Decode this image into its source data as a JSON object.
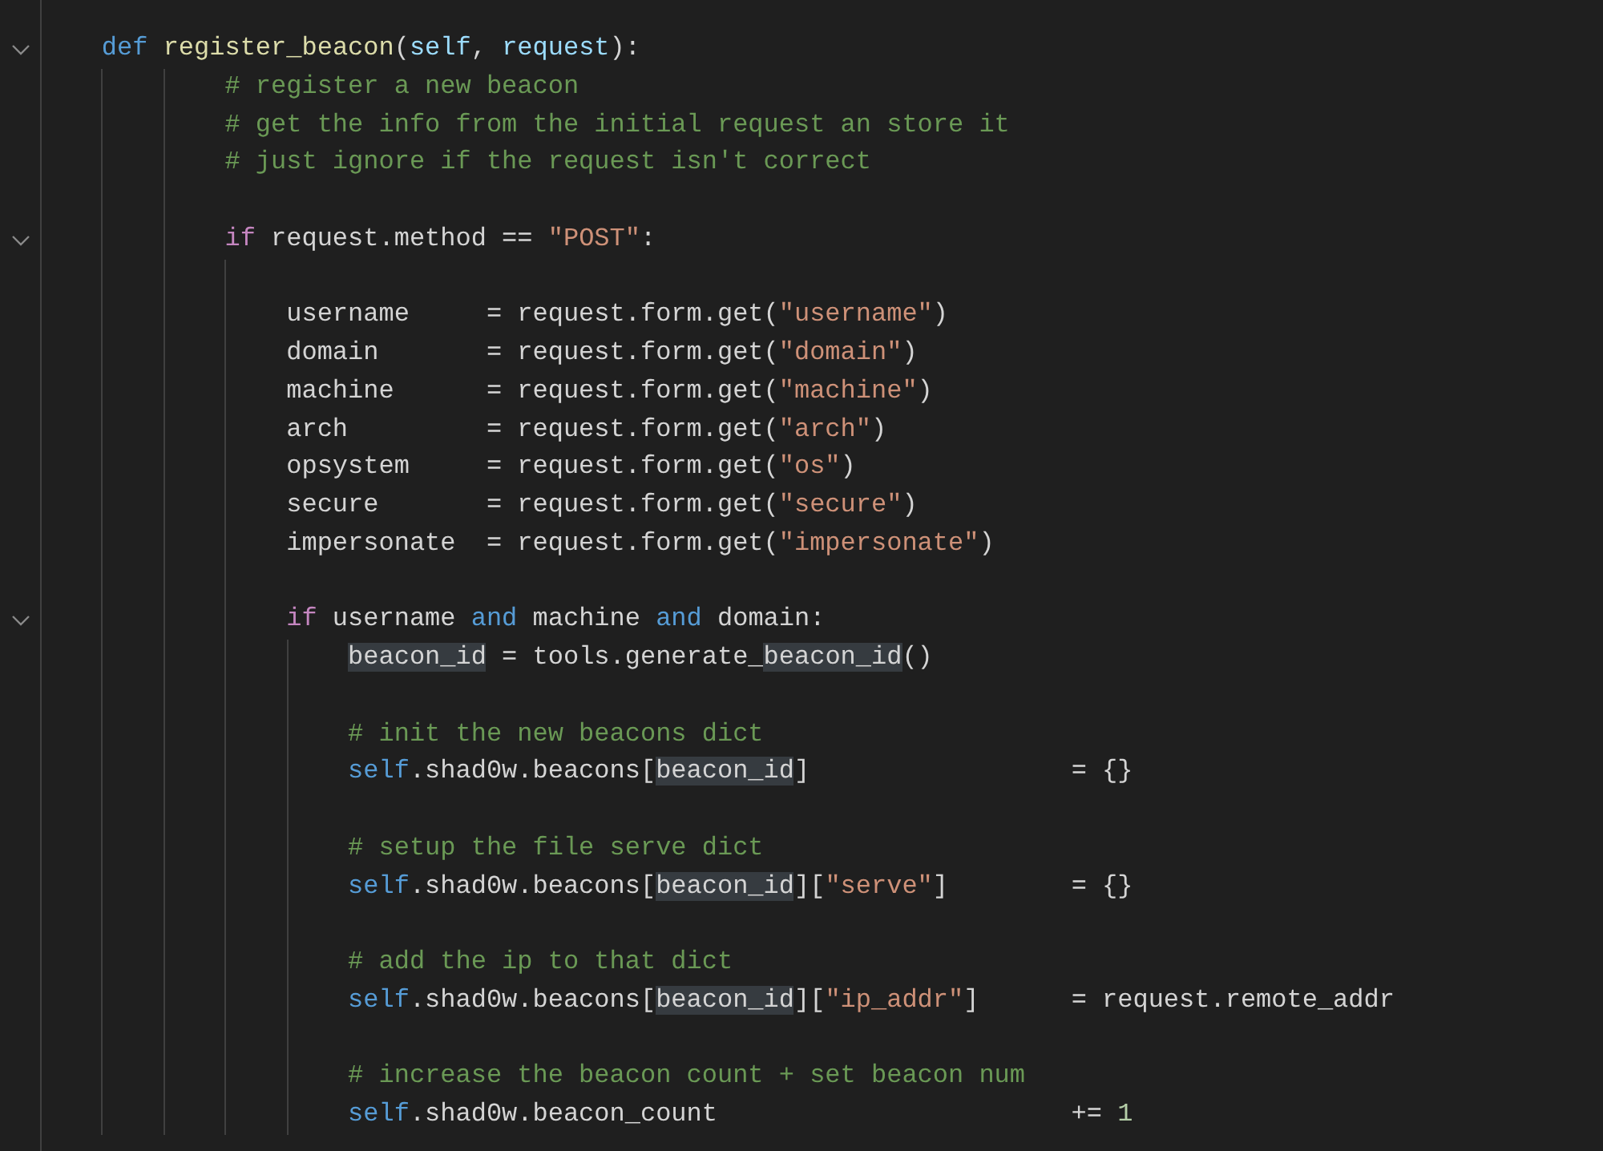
{
  "editor": {
    "lines": [
      {
        "foldable": true,
        "tokens": [
          {
            "kind": "keyword",
            "text": "    def",
            "highlighted": false
          },
          {
            "kind": "function",
            "text": " register_beacon",
            "highlighted": false
          },
          {
            "kind": "plain",
            "text": "(",
            "highlighted": false
          },
          {
            "kind": "variable",
            "text": "self",
            "highlighted": false
          },
          {
            "kind": "plain",
            "text": ", ",
            "highlighted": false
          },
          {
            "kind": "variable",
            "text": "request",
            "highlighted": false
          },
          {
            "kind": "plain",
            "text": "):",
            "highlighted": false
          }
        ]
      },
      {
        "foldable": false,
        "tokens": [
          {
            "kind": "comment",
            "text": "            # register a new beacon",
            "highlighted": false
          }
        ]
      },
      {
        "foldable": false,
        "tokens": [
          {
            "kind": "comment",
            "text": "            # get the info from the initial request an store it",
            "highlighted": false
          }
        ]
      },
      {
        "foldable": false,
        "tokens": [
          {
            "kind": "comment",
            "text": "            # just ignore if the request isn't correct",
            "highlighted": false
          }
        ]
      },
      {
        "foldable": false
      },
      {
        "foldable": true,
        "tokens": [
          {
            "kind": "control",
            "text": "            if",
            "highlighted": false
          },
          {
            "kind": "plain",
            "text": " request.method == ",
            "highlighted": false
          },
          {
            "kind": "string",
            "text": "\"POST\"",
            "highlighted": false
          },
          {
            "kind": "plain",
            "text": ":",
            "highlighted": false
          }
        ]
      },
      {
        "foldable": false
      },
      {
        "foldable": false,
        "tokens": [
          {
            "kind": "plain",
            "text": "                username     = request.form.get(",
            "highlighted": false
          },
          {
            "kind": "string",
            "text": "\"username\"",
            "highlighted": false
          },
          {
            "kind": "plain",
            "text": ")",
            "highlighted": false
          }
        ]
      },
      {
        "foldable": false,
        "tokens": [
          {
            "kind": "plain",
            "text": "                domain       = request.form.get(",
            "highlighted": false
          },
          {
            "kind": "string",
            "text": "\"domain\"",
            "highlighted": false
          },
          {
            "kind": "plain",
            "text": ")",
            "highlighted": false
          }
        ]
      },
      {
        "foldable": false,
        "tokens": [
          {
            "kind": "plain",
            "text": "                machine      = request.form.get(",
            "highlighted": false
          },
          {
            "kind": "string",
            "text": "\"machine\"",
            "highlighted": false
          },
          {
            "kind": "plain",
            "text": ")",
            "highlighted": false
          }
        ]
      },
      {
        "foldable": false,
        "tokens": [
          {
            "kind": "plain",
            "text": "                arch         = request.form.get(",
            "highlighted": false
          },
          {
            "kind": "string",
            "text": "\"arch\"",
            "highlighted": false
          },
          {
            "kind": "plain",
            "text": ")",
            "highlighted": false
          }
        ]
      },
      {
        "foldable": false,
        "tokens": [
          {
            "kind": "plain",
            "text": "                opsystem     = request.form.get(",
            "highlighted": false
          },
          {
            "kind": "string",
            "text": "\"os\"",
            "highlighted": false
          },
          {
            "kind": "plain",
            "text": ")",
            "highlighted": false
          }
        ]
      },
      {
        "foldable": false,
        "tokens": [
          {
            "kind": "plain",
            "text": "                secure       = request.form.get(",
            "highlighted": false
          },
          {
            "kind": "string",
            "text": "\"secure\"",
            "highlighted": false
          },
          {
            "kind": "plain",
            "text": ")",
            "highlighted": false
          }
        ]
      },
      {
        "foldable": false,
        "tokens": [
          {
            "kind": "plain",
            "text": "                impersonate  = request.form.get(",
            "highlighted": false
          },
          {
            "kind": "string",
            "text": "\"impersonate\"",
            "highlighted": false
          },
          {
            "kind": "plain",
            "text": ")",
            "highlighted": false
          }
        ]
      },
      {
        "foldable": false
      },
      {
        "foldable": true,
        "tokens": [
          {
            "kind": "control",
            "text": "                if",
            "highlighted": false
          },
          {
            "kind": "plain",
            "text": " username ",
            "highlighted": false
          },
          {
            "kind": "keyword",
            "text": "and",
            "highlighted": false
          },
          {
            "kind": "plain",
            "text": " machine ",
            "highlighted": false
          },
          {
            "kind": "keyword",
            "text": "and",
            "highlighted": false
          },
          {
            "kind": "plain",
            "text": " domain:",
            "highlighted": false
          }
        ]
      },
      {
        "foldable": false,
        "tokens": [
          {
            "kind": "plain",
            "text": "                    beacon_id",
            "highlighted": true
          },
          {
            "kind": "plain",
            "text": " = tools.generate_",
            "highlighted": false
          },
          {
            "kind": "plain",
            "text": "beacon_id",
            "highlighted": true
          },
          {
            "kind": "plain",
            "text": "()",
            "highlighted": false
          }
        ]
      },
      {
        "foldable": false
      },
      {
        "foldable": false,
        "tokens": [
          {
            "kind": "comment",
            "text": "                    # init the new beacons dict",
            "highlighted": false
          }
        ]
      },
      {
        "foldable": false,
        "tokens": [
          {
            "kind": "keyword",
            "text": "                    self",
            "highlighted": false
          },
          {
            "kind": "plain",
            "text": ".shad0w.beacons[",
            "highlighted": false
          },
          {
            "kind": "plain",
            "text": "beacon_id",
            "highlighted": true
          },
          {
            "kind": "plain",
            "text": "]                 = {}",
            "highlighted": false
          }
        ]
      },
      {
        "foldable": false
      },
      {
        "foldable": false,
        "tokens": [
          {
            "kind": "comment",
            "text": "                    # setup the file serve dict",
            "highlighted": false
          }
        ]
      },
      {
        "foldable": false,
        "tokens": [
          {
            "kind": "keyword",
            "text": "                    self",
            "highlighted": false
          },
          {
            "kind": "plain",
            "text": ".shad0w.beacons[",
            "highlighted": false
          },
          {
            "kind": "plain",
            "text": "beacon_id",
            "highlighted": true
          },
          {
            "kind": "plain",
            "text": "][",
            "highlighted": false
          },
          {
            "kind": "string",
            "text": "\"serve\"",
            "highlighted": false
          },
          {
            "kind": "plain",
            "text": "]        = {}",
            "highlighted": false
          }
        ]
      },
      {
        "foldable": false
      },
      {
        "foldable": false,
        "tokens": [
          {
            "kind": "comment",
            "text": "                    # add the ip to that dict",
            "highlighted": false
          }
        ]
      },
      {
        "foldable": false,
        "tokens": [
          {
            "kind": "keyword",
            "text": "                    self",
            "highlighted": false
          },
          {
            "kind": "plain",
            "text": ".shad0w.beacons[",
            "highlighted": false
          },
          {
            "kind": "plain",
            "text": "beacon_id",
            "highlighted": true
          },
          {
            "kind": "plain",
            "text": "][",
            "highlighted": false
          },
          {
            "kind": "string",
            "text": "\"ip_addr\"",
            "highlighted": false
          },
          {
            "kind": "plain",
            "text": "]      = request.remote_addr",
            "highlighted": false
          }
        ]
      },
      {
        "foldable": false
      },
      {
        "foldable": false,
        "tokens": [
          {
            "kind": "comment",
            "text": "                    # increase the beacon count + set beacon num",
            "highlighted": false
          }
        ]
      },
      {
        "foldable": false,
        "tokens": [
          {
            "kind": "keyword",
            "text": "                    self",
            "highlighted": false
          },
          {
            "kind": "plain",
            "text": ".shad0w.beacon_count                       += ",
            "highlighted": false
          },
          {
            "kind": "number",
            "text": "1",
            "highlighted": false
          }
        ]
      }
    ]
  }
}
